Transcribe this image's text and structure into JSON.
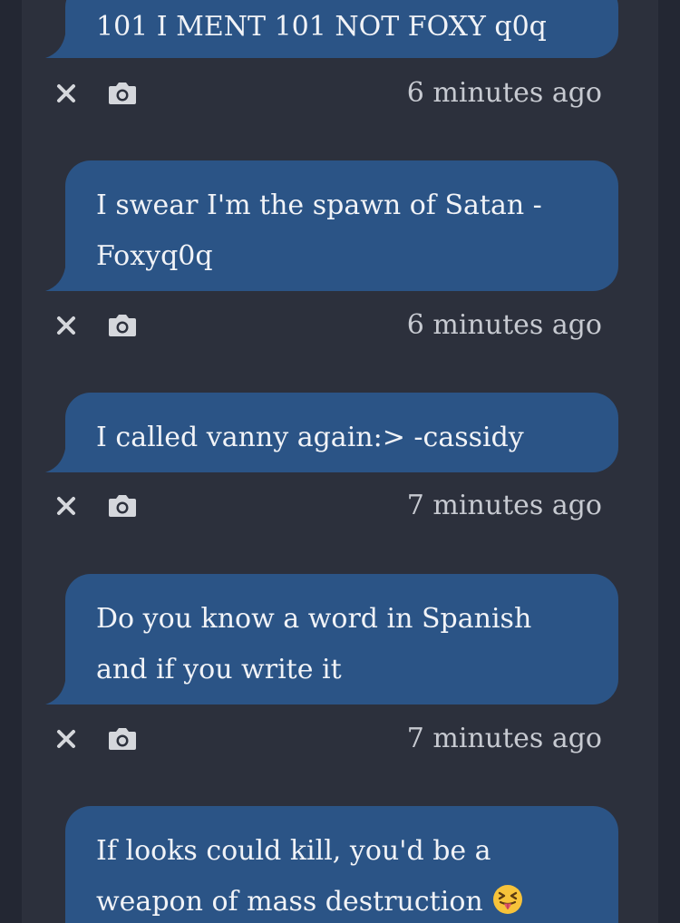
{
  "messages": [
    {
      "text": "101 I MENT 101 NOT FOXY q0q",
      "time": "6 minutes ago"
    },
    {
      "text": "I swear I'm the spawn of Satan - Foxyq0q",
      "time": "6 minutes ago"
    },
    {
      "text": "I called vanny again:> -cassidy",
      "time": "7 minutes ago"
    },
    {
      "text": "Do you know a word in Spanish and if you write it",
      "time": "7 minutes ago"
    },
    {
      "text": "If looks could kill, you'd be a weapon of mass destruction",
      "emoji": "😝"
    }
  ],
  "icons": {
    "delete": "close-icon",
    "screenshot": "camera-icon"
  },
  "colors": {
    "background": "#2c303c",
    "bubble": "#2b5486",
    "text": "#f1f3f7",
    "meta": "#c7cad1"
  }
}
